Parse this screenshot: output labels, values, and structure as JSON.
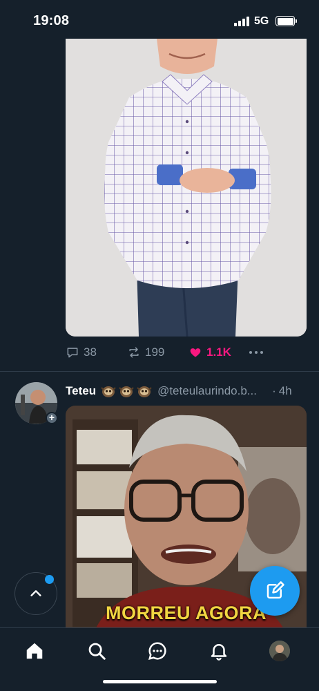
{
  "status_bar": {
    "time": "19:08",
    "network": "5G"
  },
  "tweet_top": {
    "media_icon": "photo-man-checked-shirt",
    "actions": {
      "replies": "38",
      "retweets": "199",
      "likes": "1.1K",
      "liked": true
    }
  },
  "tweet_second": {
    "name": "Teteu",
    "emoji_icons": [
      "sloth-icon",
      "sloth-icon",
      "sloth-icon"
    ],
    "handle": "@teteulaurindo.b...",
    "dot": "·",
    "time": "4h",
    "media_caption": "MORREU AGORA"
  },
  "floating": {
    "scroll_top_icon": "chevron-up-icon",
    "compose_icon": "compose-icon"
  },
  "bottom_nav": {
    "items": [
      "home-icon",
      "search-icon",
      "messages-icon",
      "notifications-icon",
      "profile-avatar"
    ]
  },
  "colors": {
    "background": "#15202b",
    "accent": "#1d9bf0",
    "like": "#f91880",
    "muted": "#8b98a5"
  }
}
